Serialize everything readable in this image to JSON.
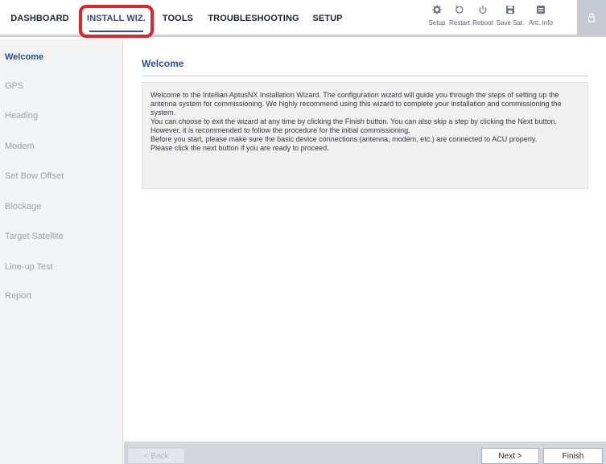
{
  "nav": {
    "tabs": [
      "DASHBOARD",
      "INSTALL WIZ.",
      "TOOLS",
      "TROUBLESHOOTING",
      "SETUP"
    ],
    "active_tab": "INSTALL WIZ."
  },
  "toolbar": [
    {
      "label": "Setup",
      "icon": "gear-icon"
    },
    {
      "label": "Restart",
      "icon": "restart-icon"
    },
    {
      "label": "Reboot",
      "icon": "power-icon"
    },
    {
      "label": "Save Sat.",
      "icon": "save-icon"
    },
    {
      "label": "Ant. Info",
      "icon": "info-box-icon"
    }
  ],
  "lock_icon": "lock-icon",
  "sidebar": {
    "items": [
      "Welcome",
      "GPS",
      "Heading",
      "Modem",
      "Set Bow Offset",
      "Blockage",
      "Target Satellite",
      "Line-up Test",
      "Report"
    ],
    "active": "Welcome"
  },
  "main": {
    "title": "Welcome",
    "paragraphs": [
      "Welcome to the Intellian AptusNX Installation Wizard. The configuration wizard will guide you through the steps of setting up the antenna system for commissioning. We highly recommend using this wizard to complete your installation and commissioning the system.",
      "You can choose to exit the wizard at any time by clicking the Finish button. You can also skip a step by clicking the Next button. However, it is recommended to follow the procedure for the initial commissioning.",
      "Before you start, please make sure the basic device connections (antenna, modem, etc.) are connected to ACU properly.",
      "Please click the next button if you are ready to proceed."
    ]
  },
  "footer": {
    "back_label": "< Back",
    "next_label": "Next >",
    "finish_label": "Finish"
  },
  "colors": {
    "accent": "#2b4d9a",
    "highlight": "#e52228",
    "sidebar_bg": "#f3f4f6",
    "footer_bg": "#d3d7dd"
  }
}
